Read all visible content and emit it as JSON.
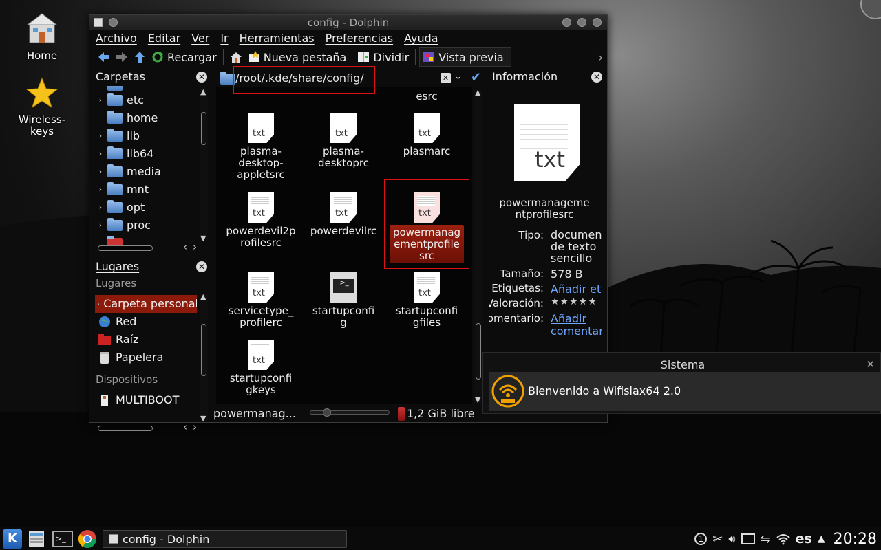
{
  "desktop": {
    "icons": [
      {
        "label": "Home",
        "icon": "home-folder-icon"
      },
      {
        "label": "Wireless-\nkeys",
        "icon": "star-icon"
      }
    ]
  },
  "window": {
    "title": "config - Dolphin",
    "menu": [
      "Archivo",
      "Editar",
      "Ver",
      "Ir",
      "Herramientas",
      "Preferencias",
      "Ayuda"
    ],
    "toolbar": {
      "reload": "Recargar",
      "new_tab": "Nueva pestaña",
      "split": "Dividir",
      "preview": "Vista previa"
    },
    "folders_panel": {
      "title": "Carpetas",
      "items": [
        "etc",
        "home",
        "lib",
        "lib64",
        "media",
        "mnt",
        "opt",
        "proc"
      ]
    },
    "places_panel": {
      "title": "Lugares",
      "section_places": "Lugares",
      "places": [
        "Carpeta personal",
        "Red",
        "Raíz",
        "Papelera"
      ],
      "section_devices": "Dispositivos",
      "devices": [
        "MULTIBOOT"
      ]
    },
    "location": "/root/.kde/share/config/",
    "files": {
      "top_partial": "esrc",
      "items": [
        "plasma-desktop-appletsrc",
        "plasma-desktoprc",
        "plasmarc",
        "powerdevil2profilesrc",
        "powerdevilrc",
        "powermanagementprofilesrc",
        "servicetype_profilerc",
        "startupconfig",
        "startupconfigfiles",
        "startupconfigkeys"
      ],
      "labels": {
        "f0": "plasma-\ndesktop-\nappletsrc",
        "f1": "plasma-\ndesktoprc",
        "f2": "plasmarc",
        "f3": "powerdevil2p\nrofilesrc",
        "f4": "powerdevilrc",
        "f5": "powermanag\nementprofile\nsrc",
        "f6": "servicetype_\nprofilerc",
        "f7": "startupconfi\ng",
        "f8": "startupconfi\ngfiles",
        "f9": "startupconfi\ngkeys"
      }
    },
    "status": {
      "selected": "powermanag...",
      "free_space": "1,2 GiB libre"
    },
    "info_panel": {
      "title": "Información",
      "name": "powermanageme\nntprofilesrc",
      "type_label": "Tipo:",
      "type_value": "documen\nde texto\nsencillo",
      "size_label": "Tamaño:",
      "size_value": "578 B",
      "tags_label": "Etiquetas:",
      "tags_value": "Añadir et",
      "rating_label": "Valoración:",
      "rating_value": "★★★★★",
      "comment_label": "Comentario:",
      "comment_value": "Añadir\ncomentar"
    }
  },
  "notification": {
    "title": "Sistema",
    "message": "Bienvenido a Wifislax64 2.0"
  },
  "taskbar": {
    "task_title": "config - Dolphin",
    "keyboard_layout": "es",
    "clock": "20:28"
  },
  "colors": {
    "accent_selection": "#8b1a0a",
    "link": "#6fa8ff",
    "highlight_box": "#dd1111"
  }
}
